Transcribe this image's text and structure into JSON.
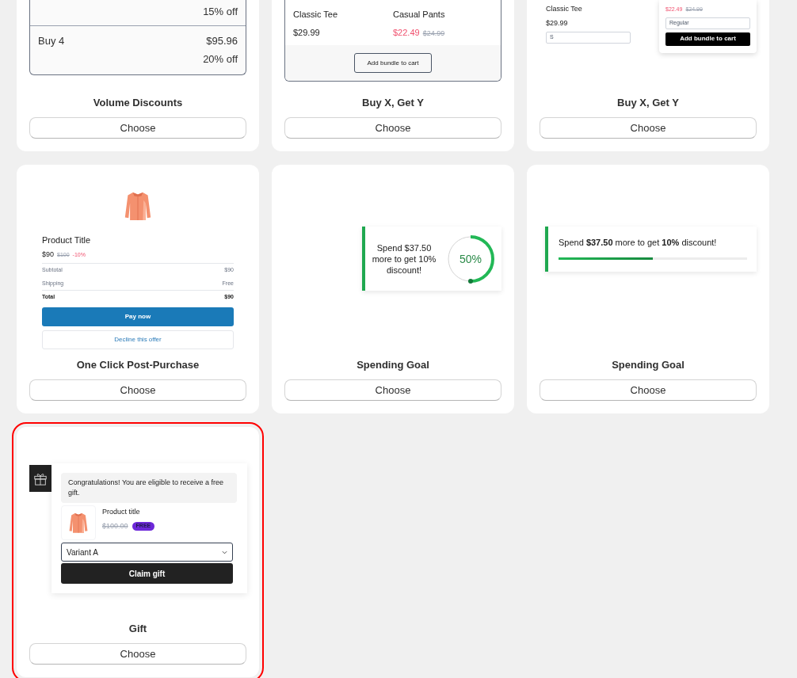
{
  "cards": [
    {
      "kind": "volume",
      "title": "Volume Discounts",
      "button": "Choose",
      "selected": false,
      "tiers": [
        {
          "discount": "15% off"
        },
        {
          "label": "Buy 4",
          "price": "$95.96",
          "discount": "20% off"
        }
      ]
    },
    {
      "kind": "bundle",
      "title": "Buy X, Get Y",
      "button": "Choose",
      "selected": false,
      "products": [
        {
          "name": "Classic Tee",
          "price": "$29.99"
        },
        {
          "name": "Casual Pants",
          "price": "$22.49",
          "compare": "$24.99"
        }
      ],
      "action": "Add bundle to cart"
    },
    {
      "kind": "bundle_popup",
      "title": "Buy X, Get Y",
      "button": "Choose",
      "selected": false,
      "left": {
        "name": "Classic Tee",
        "price": "$29.99",
        "option": "S"
      },
      "right": {
        "price": "$22.49",
        "compare": "$24.99",
        "option": "Regular"
      },
      "action": "Add bundle to cart"
    },
    {
      "kind": "post_purchase",
      "title": "One Click Post-Purchase",
      "button": "Choose",
      "selected": false,
      "product": "Product Title",
      "price": "$90",
      "compare": "$100",
      "discount": "-10%",
      "lines": [
        {
          "label": "Subtotal",
          "value": "$90",
          "bold": false
        },
        {
          "label": "Shipping",
          "value": "Free",
          "bold": false
        },
        {
          "label": "Total",
          "value": "$90",
          "bold": true
        }
      ],
      "pay": "Pay now",
      "decline": "Decline this offer"
    },
    {
      "kind": "goal_circle",
      "title": "Spending Goal",
      "button": "Choose",
      "selected": false,
      "message": "Spend $37.50 more to get 10% discount!",
      "level": 0.5,
      "percent": "50%"
    },
    {
      "kind": "goal_bar",
      "title": "Spending Goal",
      "button": "Choose",
      "selected": false,
      "message": "Spend **$37.50** more to get **10%** discount!",
      "level": 0.5
    },
    {
      "kind": "gift",
      "title": "Gift",
      "button": "Choose",
      "selected": true,
      "message": "Congratulations! You are eligible to receive a free gift.",
      "product": "Product title",
      "compare": "$100.00",
      "badge": "FREE",
      "variant": "Variant A",
      "action": "Claim gift"
    }
  ]
}
